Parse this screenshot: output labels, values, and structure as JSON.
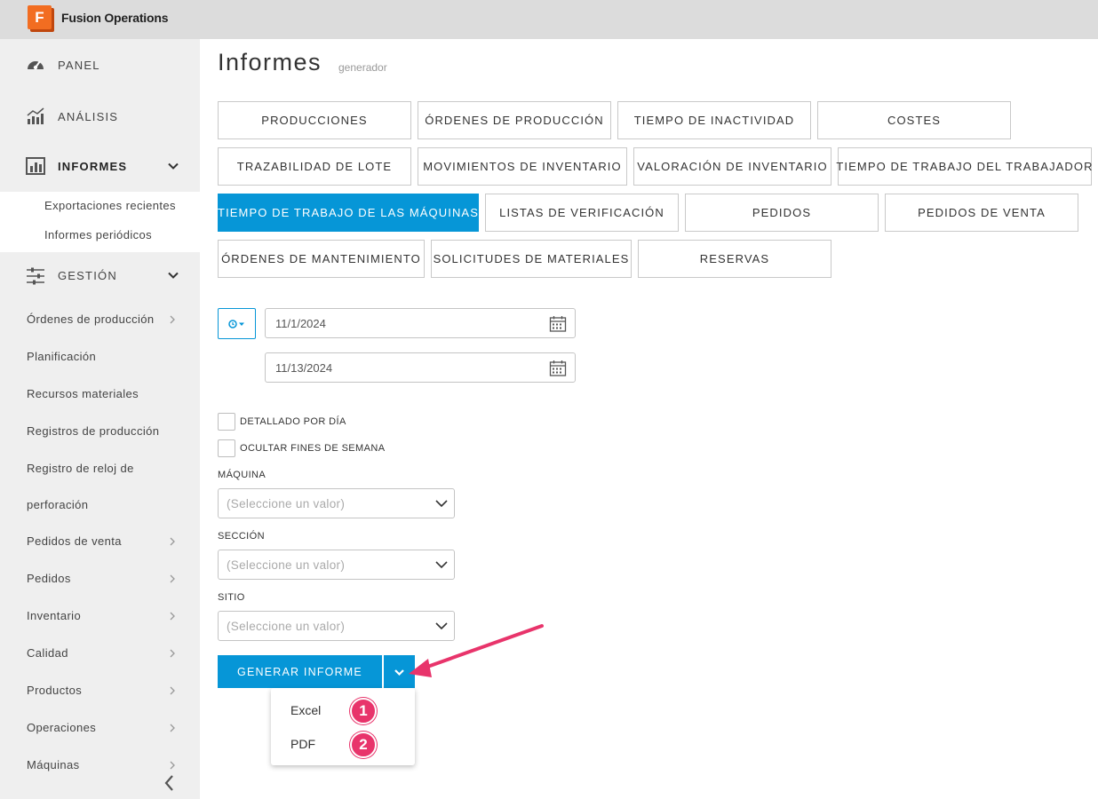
{
  "app": {
    "title": "Fusion Operations",
    "logo_letter": "F"
  },
  "sidebar": {
    "main": [
      {
        "label": "PANEL",
        "icon": "gauge-icon"
      },
      {
        "label": "ANÁLISIS",
        "icon": "bar-chart-icon"
      },
      {
        "label": "INFORMES",
        "icon": "report-icon",
        "expanded": true
      },
      {
        "label": "GESTIÓN",
        "icon": "sliders-icon",
        "expanded": true
      }
    ],
    "informes_sub": [
      "Exportaciones recientes",
      "Informes periódicos"
    ],
    "gestion_items": [
      "Órdenes de producción",
      "Planificación",
      "Recursos materiales",
      "Registros de producción",
      "Registro de reloj de",
      "perforación",
      "Pedidos de venta",
      "Pedidos",
      "Inventario",
      "Calidad",
      "Productos",
      "Operaciones",
      "Máquinas"
    ]
  },
  "page": {
    "title": "Informes",
    "subtitle": "generador"
  },
  "report_types": [
    "PRODUCCIONES",
    "ÓRDENES DE PRODUCCIÓN",
    "TIEMPO DE INACTIVIDAD",
    "COSTES",
    "TRAZABILIDAD DE LOTE",
    "MOVIMIENTOS DE INVENTARIO",
    "VALORACIÓN DE INVENTARIO",
    "TIEMPO DE TRABAJO DEL TRABAJADOR",
    "TIEMPO DE TRABAJO DE LAS MÁQUINAS",
    "LISTAS DE VERIFICACIÓN",
    "PEDIDOS",
    "PEDIDOS DE VENTA",
    "ÓRDENES DE MANTENIMIENTO",
    "SOLICITUDES DE MATERIALES",
    "RESERVAS"
  ],
  "active_report": "TIEMPO DE TRABAJO DE LAS MÁQUINAS",
  "form": {
    "date_from": "11/1/2024",
    "date_to": "11/13/2024",
    "checkboxes": [
      {
        "label": "DETALLADO POR DÍA",
        "checked": false
      },
      {
        "label": "OCULTAR FINES DE SEMANA",
        "checked": false
      }
    ],
    "fields": [
      {
        "label": "MÁQUINA",
        "placeholder": "(Seleccione un valor)"
      },
      {
        "label": "SECCIÓN",
        "placeholder": "(Seleccione un valor)"
      },
      {
        "label": "SITIO",
        "placeholder": "(Seleccione un valor)"
      }
    ]
  },
  "generate": {
    "label": "GENERAR INFORME",
    "menu": [
      "Excel",
      "PDF"
    ],
    "badges": [
      "1",
      "2"
    ]
  },
  "colors": {
    "accent": "#0696d7",
    "badge": "#e8346b",
    "arrow": "#e8346b",
    "logo": "#f26d21"
  }
}
